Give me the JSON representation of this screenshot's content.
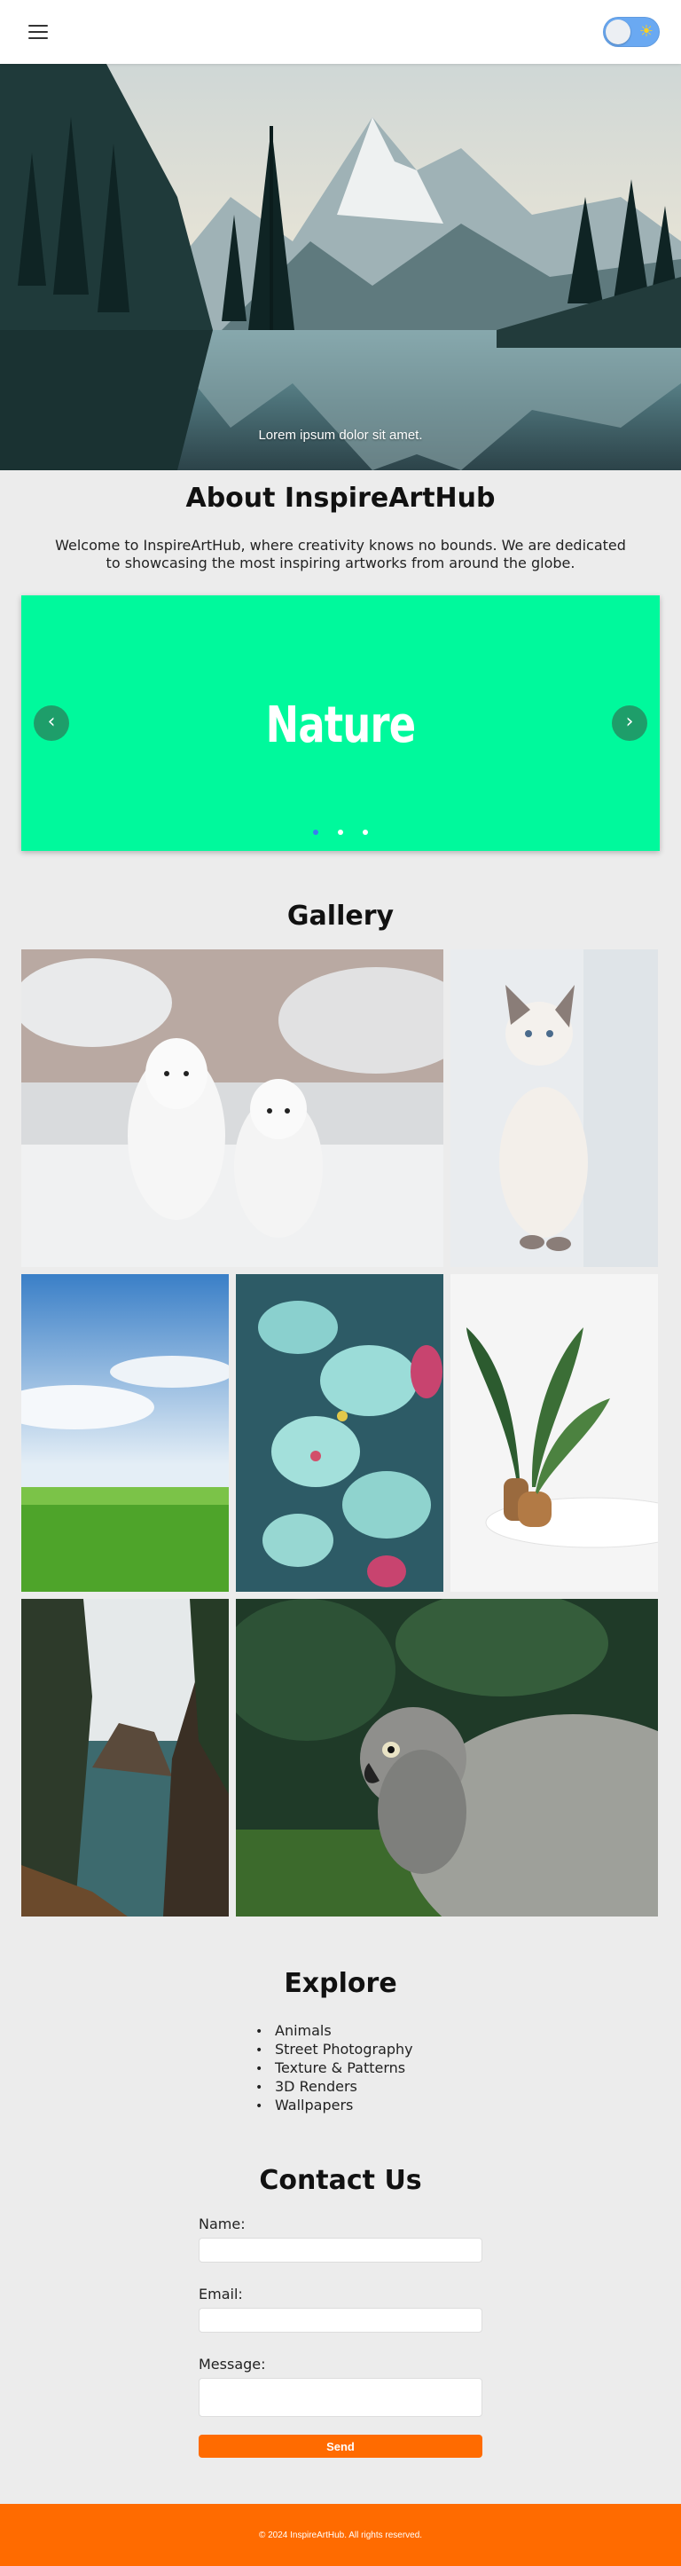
{
  "header": {
    "menu_icon": "hamburger-menu-icon",
    "theme_toggle_icon": "sun-icon",
    "theme_toggle_color": "#6aa9f2"
  },
  "hero": {
    "image": "mountain-lake-landscape",
    "tagline": "Lorem ipsum dolor sit amet."
  },
  "about": {
    "title": "About InspireArtHub",
    "text": "Welcome to InspireArtHub, where creativity knows no bounds. We are dedicated to showcasing the most inspiring artworks from around the globe."
  },
  "carousel": {
    "slide_label": "Nature",
    "background": "#00f99c",
    "prev_icon": "chevron-left-icon",
    "next_icon": "chevron-right-icon",
    "slide_count": 3,
    "active_slide": 1
  },
  "gallery": {
    "title": "Gallery",
    "images": [
      "two white samoyed dogs in snow",
      "white kitten by window",
      "green grass field under blue sky",
      "teal orchid flowers",
      "plant in wooden vases",
      "sea cove between cliffs with pine trees",
      "grey parrot on a rock"
    ]
  },
  "explore": {
    "title": "Explore",
    "items": [
      "Animals",
      "Street Photography",
      "Texture & Patterns",
      "3D Renders",
      "Wallpapers"
    ]
  },
  "contact": {
    "title": "Contact Us",
    "name_label": "Name:",
    "email_label": "Email:",
    "message_label": "Message:",
    "name_value": "",
    "email_value": "",
    "message_value": "",
    "send_label": "Send"
  },
  "footer": {
    "text": "© 2024 InspireArtHub. All rights reserved.",
    "accent": "#ff6b00"
  }
}
